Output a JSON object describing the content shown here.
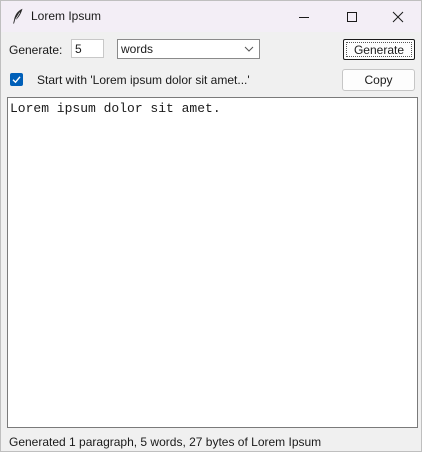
{
  "window": {
    "title": "Lorem Ipsum"
  },
  "controls": {
    "generate_label": "Generate:",
    "count_value": "5",
    "unit_selected": "words",
    "generate_button": "Generate",
    "copy_button": "Copy",
    "start_with_label": "Start with 'Lorem ipsum dolor sit amet...'",
    "start_with_checked": true
  },
  "output": {
    "text": "Lorem ipsum dolor sit amet."
  },
  "status": {
    "text": "Generated 1 paragraph, 5 words, 27 bytes of Lorem Ipsum"
  },
  "colors": {
    "accent": "#005fb8",
    "titlebar": "#f3eef6",
    "window_bg": "#f0f0f0"
  }
}
